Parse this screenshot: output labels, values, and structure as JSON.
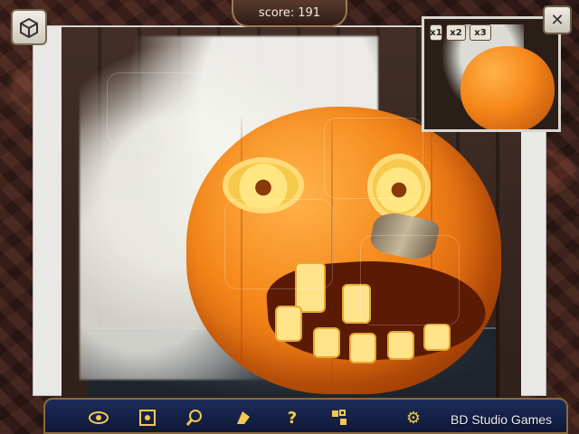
{
  "score": {
    "label": "score:",
    "value": "191"
  },
  "preview": {
    "multipliers": [
      "x1",
      "x2",
      "x3"
    ]
  },
  "toolbar": {
    "brand": "BD Studio Games"
  },
  "icons": {
    "box": "box-icon",
    "close": "close-icon",
    "eye": "eye-icon",
    "pieces": "pieces-icon",
    "magnifier": "magnifier-icon",
    "edges": "edge-pieces-icon",
    "hint": "question-icon",
    "shuffle": "shuffle-icon",
    "settings": "gear-icon"
  },
  "colors": {
    "accent": "#f2c94c",
    "toolbar": "#1e2c5a"
  }
}
